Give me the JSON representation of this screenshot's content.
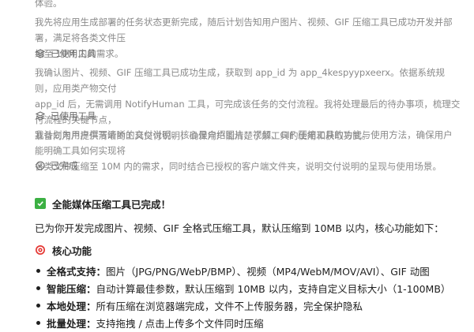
{
  "thought": {
    "top_fragment": "体验。",
    "p1": [
      "我先将应用生成部署的任务状态更新完成，随后计划告知用户图片、视频、GIF 压缩工具已成功开发并部署，满足将各类文件压",
      "缩至 10M 内的需求。"
    ],
    "step1_label": "已使用工具",
    "p2": [
      "我确认图片、视频、GIF 压缩工具已成功生成，获取到 app_id 为 app_4kespyypxeerx。依据系统规则，应用类产物交付",
      "app_id 后，无需调用 NotifyHuman 工具，可完成该任务的交付流程。我将处理最后的待办事项，梳理交付流程的关键节点，",
      "准备向用户提供清晰的工具交付说明，确保用户能清楚了解工具的使用和获取方式。"
    ],
    "step2_label": "已使用工具",
    "p3": [
      "我计划为用户撰写清晰的交付说明，核心是介绍图片、视频、GIF 压缩工具的功能与使用方法，确保用户能明确工具如何实现将",
      "各类文件压缩至 10M 内的需求，同时结合已授权的客户端文件夹，说明交付说明的呈现与使用场景。"
    ],
    "done_label": "已完成"
  },
  "answer": {
    "headline": "全能媒体压缩工具已完成！",
    "intro": "已为你开发完成图片、视频、GIF 全格式压缩工具，默认压缩到 10MB 以内，核心功能如下：",
    "section_title": "核心功能",
    "features": [
      {
        "key": "全格式支持：",
        "text": "图片（JPG/PNG/WebP/BMP）、视频（MP4/WebM/MOV/AVI）、GIF 动图"
      },
      {
        "key": "智能压缩：",
        "text": "自动计算最佳参数，默认压缩到 10MB 以内，支持自定义目标大小（1-100MB）"
      },
      {
        "key": "本地处理：",
        "text": "所有压缩在浏览器端完成，文件不上传服务器，完全保护隐私"
      },
      {
        "key": "批量处理：",
        "text": "支持拖拽 / 点击上传多个文件同时压缩"
      }
    ]
  },
  "colors": {
    "check": "#3cb043",
    "target": "#e53935",
    "muted": "#8a8a8a"
  }
}
